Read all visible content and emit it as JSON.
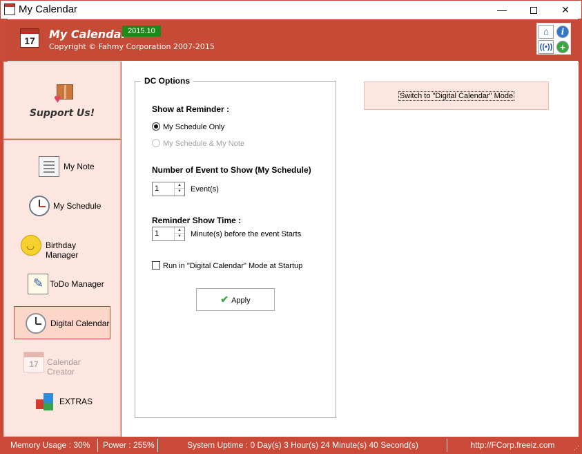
{
  "window": {
    "title": "My Calendar",
    "minimize": "—",
    "close": "✕"
  },
  "header": {
    "app_name": "My Calendar",
    "version": "2015.10",
    "copyright": "Copyright © Fahmy Corporation 2007-2015",
    "calendar_day": "17",
    "icons": [
      "home-icon",
      "info-icon",
      "rss-icon",
      "add-icon"
    ]
  },
  "sidebar": {
    "support_label": "Support Us!",
    "items": [
      {
        "label": "My Note",
        "icon": "note-icon"
      },
      {
        "label": "My Schedule",
        "icon": "clock-icon"
      },
      {
        "label": "Birthday Manager",
        "icon": "smiley-icon"
      },
      {
        "label": "ToDo Manager",
        "icon": "todo-icon"
      },
      {
        "label": "Digital Calendar",
        "icon": "digital-clock-icon",
        "active": true
      },
      {
        "label": "Calendar Creator",
        "icon": "calendar-icon",
        "disabled": true
      },
      {
        "label": "EXTRAS",
        "icon": "cubes-icon"
      }
    ],
    "calendar_creator_day": "17"
  },
  "dc_options": {
    "title": "DC Options",
    "show_at_reminder_label": "Show at Reminder :",
    "radio_schedule_only": "My Schedule Only",
    "radio_schedule_note": "My Schedule & My Note",
    "events_label": "Number of Event to Show (My Schedule)",
    "events_value": "1",
    "events_unit": "Event(s)",
    "reminder_time_label": "Reminder Show Time :",
    "reminder_value": "1",
    "reminder_unit": "Minute(s) before the event Starts",
    "startup_checkbox": "Run in \"Digital Calendar\" Mode at Startup",
    "apply_label": "Apply"
  },
  "switch_button": "Switch to \"Digital Calendar\" Mode",
  "statusbar": {
    "memory": "Memory Usage : 30%",
    "power": "Power : 255%",
    "uptime": "System Uptime : 0 Day(s) 3 Hour(s) 24 Minute(s) 40 Second(s)",
    "url": "http://FCorp.freeiz.com"
  }
}
